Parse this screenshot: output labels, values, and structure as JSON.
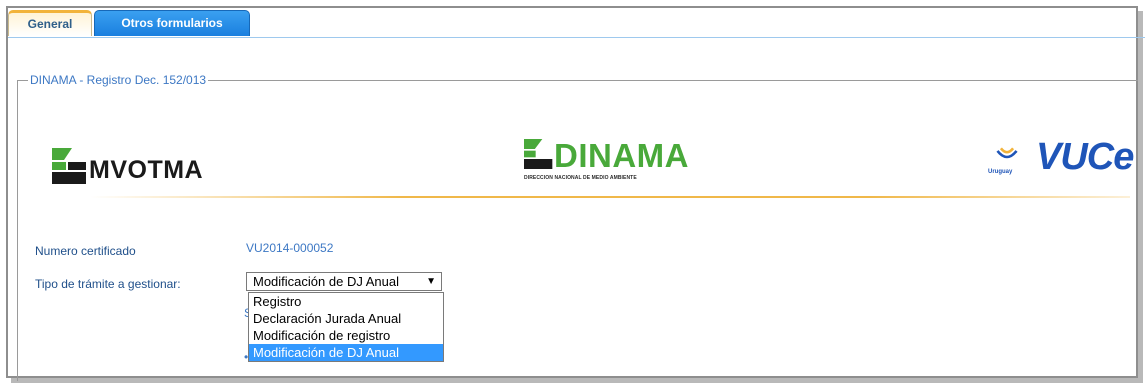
{
  "tabs": [
    {
      "label": "General",
      "active": true
    },
    {
      "label": "Otros formularios",
      "active": false
    }
  ],
  "fieldset": {
    "legend": "DINAMA - Registro Dec. 152/013"
  },
  "logos": {
    "mvotma": "MVOTMA",
    "dinama": "DINAMA",
    "dinama_sub": "DIRECCION NACIONAL DE MEDIO AMBIENTE",
    "vuce": "VUCe",
    "uruguay": "Uruguay"
  },
  "form": {
    "numero_label": "Numero certificado",
    "numero_value": "VU2014-000052",
    "tipo_label": "Tipo de trámite a gestionar:",
    "tipo_selected": "Modificación de DJ Anual",
    "options": [
      "Registro",
      "Declaración Jurada Anual",
      "Modificación de registro",
      "Modificación de DJ Anual"
    ]
  },
  "colors": {
    "tab_active_text": "#2f5f8a",
    "tab_blue": "#1a7fdf",
    "dinama_green": "#49a93a",
    "vuce_blue": "#1f55b8",
    "selection": "#3399ff"
  }
}
